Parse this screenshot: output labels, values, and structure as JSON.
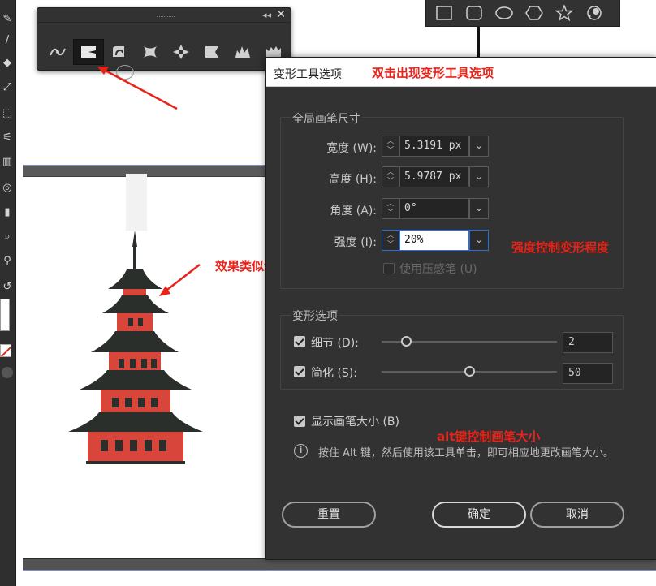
{
  "dialog": {
    "title": "变形工具选项",
    "global_brush": {
      "legend": "全局画笔尺寸",
      "width_label": "宽度 (W):",
      "width_value": "5.3191 px",
      "height_label": "高度 (H):",
      "height_value": "5.9787 px",
      "angle_label": "角度 (A):",
      "angle_value": "0°",
      "intensity_label": "强度 (I):",
      "intensity_value": "20%",
      "pressure_label": "使用压感笔 (U)"
    },
    "warp_options": {
      "legend": "变形选项",
      "detail_label": "细节 (D):",
      "detail_value": "2",
      "detail_fraction": 0.14,
      "simplify_label": "简化 (S):",
      "simplify_value": "50",
      "simplify_fraction": 0.5
    },
    "show_brush_label": "显示画笔大小 (B)",
    "info_text": "按住 Alt 键，然后使用该工具单击，即可相应地更改画笔大小。",
    "reset_label": "重置",
    "ok_label": "确定",
    "cancel_label": "取消"
  },
  "annotations": {
    "title_note": "双击出现变形工具选项",
    "liquify_note": "效果类似液化",
    "intensity_note": "强度控制变形程度",
    "alt_note": "alt键控制画笔大小"
  },
  "tool_flyout": {
    "tools": [
      "width-tool",
      "warp-tool",
      "twirl-tool",
      "pucker-tool",
      "bloat-tool",
      "scallop-tool",
      "crystallize-tool",
      "wrinkle-tool"
    ],
    "active": "warp-tool",
    "collapse_icon": "◂◂",
    "close_icon": "✕"
  },
  "shape_flyout": {
    "tools": [
      "rectangle-tool",
      "rounded-rectangle-tool",
      "ellipse-tool",
      "polygon-tool",
      "star-tool",
      "flare-tool"
    ]
  },
  "colors": {
    "annotation_red": "#e8231a",
    "dialog_bg": "#323232",
    "focus_blue": "#2c6fd6",
    "pagoda_red": "#d8453a",
    "pagoda_roof": "#2b2f2c"
  }
}
